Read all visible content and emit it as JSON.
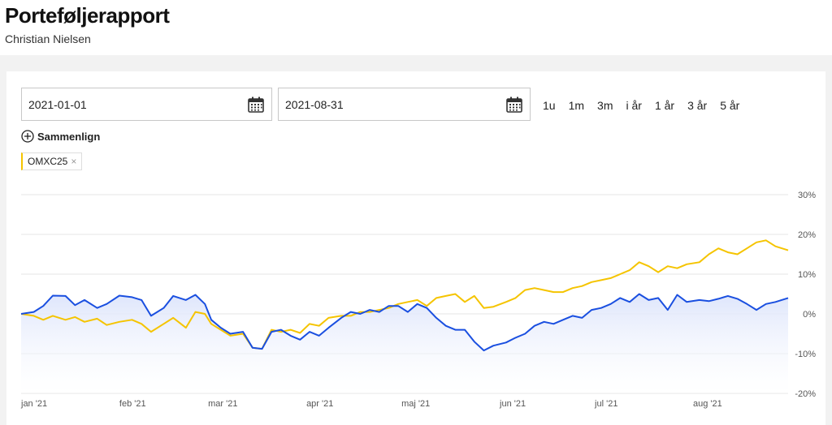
{
  "header": {
    "title": "Porteføljerapport",
    "subtitle": "Christian Nielsen"
  },
  "filters": {
    "from_date": "2021-01-01",
    "to_date": "2021-08-31",
    "ranges": [
      "1u",
      "1m",
      "3m",
      "i år",
      "1 år",
      "3 år",
      "5 år"
    ],
    "compare_label": "Sammenlign",
    "compare_chip": "OMXC25",
    "chip_close": "×"
  },
  "colors": {
    "portfolio": "#1a4fe0",
    "benchmark": "#f5c400",
    "fill": "#dce4fb"
  },
  "chart_data": {
    "type": "line",
    "x_type": "date",
    "xlim": [
      "2021-01-01",
      "2021-08-31"
    ],
    "ylim": [
      -20,
      30
    ],
    "y_ticks": [
      30,
      20,
      10,
      0,
      -10,
      -20
    ],
    "y_tick_labels": [
      "30%",
      "20%",
      "10%",
      "0%",
      "-10%",
      "-20%"
    ],
    "x_ticks": [
      "2021-01-01",
      "2021-02-01",
      "2021-03-01",
      "2021-04-01",
      "2021-05-01",
      "2021-06-01",
      "2021-07-01",
      "2021-08-01"
    ],
    "x_tick_labels": [
      "jan '21",
      "feb '21",
      "mar '21",
      "apr '21",
      "maj '21",
      "jun '21",
      "jul '21",
      "aug '21"
    ],
    "grid": true,
    "series": [
      {
        "color": "#1a4fe0",
        "area": true,
        "points": [
          [
            "2021-01-01",
            0
          ],
          [
            "2021-01-05",
            0.5
          ],
          [
            "2021-01-08",
            2
          ],
          [
            "2021-01-11",
            4.6
          ],
          [
            "2021-01-15",
            4.5
          ],
          [
            "2021-01-18",
            2.2
          ],
          [
            "2021-01-21",
            3.5
          ],
          [
            "2021-01-25",
            1.5
          ],
          [
            "2021-01-28",
            2.5
          ],
          [
            "2021-02-01",
            4.6
          ],
          [
            "2021-02-05",
            4.2
          ],
          [
            "2021-02-08",
            3.5
          ],
          [
            "2021-02-11",
            -0.5
          ],
          [
            "2021-02-15",
            1.5
          ],
          [
            "2021-02-18",
            4.5
          ],
          [
            "2021-02-22",
            3.5
          ],
          [
            "2021-02-25",
            4.8
          ],
          [
            "2021-02-28",
            2.5
          ],
          [
            "2021-03-02",
            -1.5
          ],
          [
            "2021-03-05",
            -3.5
          ],
          [
            "2021-03-08",
            -5
          ],
          [
            "2021-03-12",
            -4.5
          ],
          [
            "2021-03-15",
            -8.5
          ],
          [
            "2021-03-18",
            -8.8
          ],
          [
            "2021-03-21",
            -4.5
          ],
          [
            "2021-03-24",
            -4
          ],
          [
            "2021-03-27",
            -5.5
          ],
          [
            "2021-03-30",
            -6.5
          ],
          [
            "2021-04-02",
            -4.5
          ],
          [
            "2021-04-05",
            -5.5
          ],
          [
            "2021-04-08",
            -3.5
          ],
          [
            "2021-04-12",
            -1
          ],
          [
            "2021-04-15",
            0.5
          ],
          [
            "2021-04-18",
            0
          ],
          [
            "2021-04-21",
            1
          ],
          [
            "2021-04-24",
            0.5
          ],
          [
            "2021-04-27",
            2
          ],
          [
            "2021-04-30",
            2
          ],
          [
            "2021-05-03",
            0.5
          ],
          [
            "2021-05-06",
            2.5
          ],
          [
            "2021-05-09",
            1.5
          ],
          [
            "2021-05-12",
            -1
          ],
          [
            "2021-05-15",
            -3
          ],
          [
            "2021-05-18",
            -4
          ],
          [
            "2021-05-21",
            -4
          ],
          [
            "2021-05-24",
            -7
          ],
          [
            "2021-05-27",
            -9.2
          ],
          [
            "2021-05-30",
            -8
          ],
          [
            "2021-06-03",
            -7.2
          ],
          [
            "2021-06-06",
            -6
          ],
          [
            "2021-06-09",
            -5
          ],
          [
            "2021-06-12",
            -3
          ],
          [
            "2021-06-15",
            -2
          ],
          [
            "2021-06-18",
            -2.5
          ],
          [
            "2021-06-21",
            -1.5
          ],
          [
            "2021-06-24",
            -0.5
          ],
          [
            "2021-06-27",
            -1
          ],
          [
            "2021-06-30",
            1
          ],
          [
            "2021-07-03",
            1.5
          ],
          [
            "2021-07-06",
            2.5
          ],
          [
            "2021-07-09",
            4
          ],
          [
            "2021-07-12",
            3
          ],
          [
            "2021-07-15",
            5
          ],
          [
            "2021-07-18",
            3.5
          ],
          [
            "2021-07-21",
            4
          ],
          [
            "2021-07-24",
            1
          ],
          [
            "2021-07-27",
            4.8
          ],
          [
            "2021-07-30",
            3
          ],
          [
            "2021-08-03",
            3.5
          ],
          [
            "2021-08-06",
            3.2
          ],
          [
            "2021-08-09",
            3.8
          ],
          [
            "2021-08-12",
            4.5
          ],
          [
            "2021-08-15",
            3.8
          ],
          [
            "2021-08-18",
            2.5
          ],
          [
            "2021-08-21",
            1
          ],
          [
            "2021-08-24",
            2.5
          ],
          [
            "2021-08-27",
            3
          ],
          [
            "2021-08-31",
            4
          ]
        ]
      },
      {
        "color": "#f5c400",
        "area": false,
        "points": [
          [
            "2021-01-01",
            0
          ],
          [
            "2021-01-05",
            -0.5
          ],
          [
            "2021-01-08",
            -1.5
          ],
          [
            "2021-01-11",
            -0.5
          ],
          [
            "2021-01-15",
            -1.5
          ],
          [
            "2021-01-18",
            -0.8
          ],
          [
            "2021-01-21",
            -2
          ],
          [
            "2021-01-25",
            -1.2
          ],
          [
            "2021-01-28",
            -2.8
          ],
          [
            "2021-02-01",
            -2
          ],
          [
            "2021-02-05",
            -1.5
          ],
          [
            "2021-02-08",
            -2.5
          ],
          [
            "2021-02-11",
            -4.5
          ],
          [
            "2021-02-15",
            -2.5
          ],
          [
            "2021-02-18",
            -1
          ],
          [
            "2021-02-22",
            -3.5
          ],
          [
            "2021-02-25",
            0.5
          ],
          [
            "2021-02-28",
            0
          ],
          [
            "2021-03-02",
            -2.5
          ],
          [
            "2021-03-05",
            -4
          ],
          [
            "2021-03-08",
            -5.5
          ],
          [
            "2021-03-12",
            -5
          ],
          [
            "2021-03-15",
            -8.5
          ],
          [
            "2021-03-18",
            -8.8
          ],
          [
            "2021-03-21",
            -4
          ],
          [
            "2021-03-24",
            -4.5
          ],
          [
            "2021-03-27",
            -4
          ],
          [
            "2021-03-30",
            -4.8
          ],
          [
            "2021-04-02",
            -2.5
          ],
          [
            "2021-04-05",
            -3
          ],
          [
            "2021-04-08",
            -1
          ],
          [
            "2021-04-12",
            -0.5
          ],
          [
            "2021-04-15",
            -0.5
          ],
          [
            "2021-04-18",
            0.5
          ],
          [
            "2021-04-21",
            0.5
          ],
          [
            "2021-04-24",
            1
          ],
          [
            "2021-04-27",
            1.5
          ],
          [
            "2021-04-30",
            2.5
          ],
          [
            "2021-05-03",
            3
          ],
          [
            "2021-05-06",
            3.5
          ],
          [
            "2021-05-09",
            2
          ],
          [
            "2021-05-12",
            4
          ],
          [
            "2021-05-15",
            4.5
          ],
          [
            "2021-05-18",
            5
          ],
          [
            "2021-05-21",
            3
          ],
          [
            "2021-05-24",
            4.5
          ],
          [
            "2021-05-27",
            1.5
          ],
          [
            "2021-05-30",
            1.8
          ],
          [
            "2021-06-03",
            3
          ],
          [
            "2021-06-06",
            4
          ],
          [
            "2021-06-09",
            6
          ],
          [
            "2021-06-12",
            6.5
          ],
          [
            "2021-06-15",
            6
          ],
          [
            "2021-06-18",
            5.5
          ],
          [
            "2021-06-21",
            5.5
          ],
          [
            "2021-06-24",
            6.5
          ],
          [
            "2021-06-27",
            7
          ],
          [
            "2021-06-30",
            8
          ],
          [
            "2021-07-03",
            8.5
          ],
          [
            "2021-07-06",
            9
          ],
          [
            "2021-07-09",
            10
          ],
          [
            "2021-07-12",
            11
          ],
          [
            "2021-07-15",
            13
          ],
          [
            "2021-07-18",
            12
          ],
          [
            "2021-07-21",
            10.5
          ],
          [
            "2021-07-24",
            12
          ],
          [
            "2021-07-27",
            11.5
          ],
          [
            "2021-07-30",
            12.5
          ],
          [
            "2021-08-03",
            13
          ],
          [
            "2021-08-06",
            15
          ],
          [
            "2021-08-09",
            16.5
          ],
          [
            "2021-08-12",
            15.5
          ],
          [
            "2021-08-15",
            15
          ],
          [
            "2021-08-18",
            16.5
          ],
          [
            "2021-08-21",
            18
          ],
          [
            "2021-08-24",
            18.5
          ],
          [
            "2021-08-27",
            17
          ],
          [
            "2021-08-31",
            16
          ]
        ]
      }
    ]
  }
}
